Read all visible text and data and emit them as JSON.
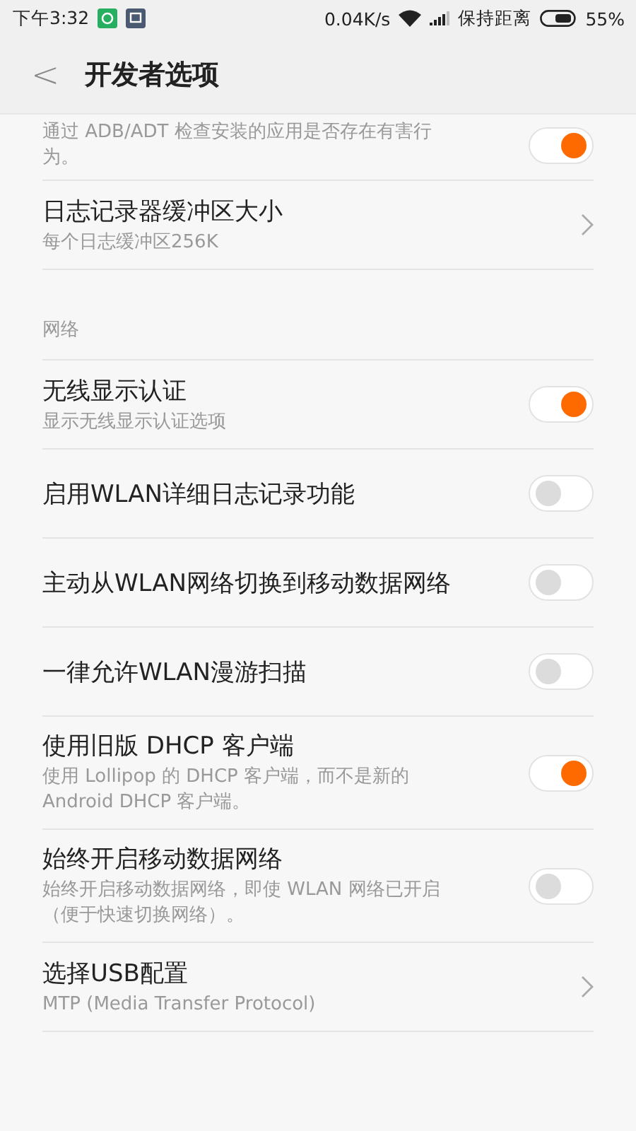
{
  "status_bar": {
    "time": "下午3:32",
    "speed": "0.04K/s",
    "carrier": "保持距离",
    "battery": "55%"
  },
  "header": {
    "back": "<",
    "title": "开发者选项"
  },
  "items": [
    {
      "kind": "toggle",
      "summary": "通过 ADB/ADT 检查安装的应用是否存在有害行为。",
      "on": true
    },
    {
      "kind": "link",
      "title": "日志记录器缓冲区大小",
      "summary": "每个日志缓冲区256K"
    },
    {
      "kind": "section",
      "title": "网络"
    },
    {
      "kind": "toggle",
      "title": "无线显示认证",
      "summary": "显示无线显示认证选项",
      "on": true
    },
    {
      "kind": "toggle",
      "title": "启用WLAN详细日志记录功能",
      "on": false
    },
    {
      "kind": "toggle",
      "title": "主动从WLAN网络切换到移动数据网络",
      "on": false
    },
    {
      "kind": "toggle",
      "title": "一律允许WLAN漫游扫描",
      "on": false
    },
    {
      "kind": "toggle",
      "title": "使用旧版 DHCP 客户端",
      "summary": "使用 Lollipop 的 DHCP 客户端，而不是新的 Android DHCP 客户端。",
      "on": true
    },
    {
      "kind": "toggle",
      "title": "始终开启移动数据网络",
      "summary": "始终开启移动数据网络，即使 WLAN 网络已开启（便于快速切换网络）。",
      "on": false
    },
    {
      "kind": "link",
      "title": "选择USB配置",
      "summary": "MTP (Media Transfer Protocol)"
    }
  ]
}
